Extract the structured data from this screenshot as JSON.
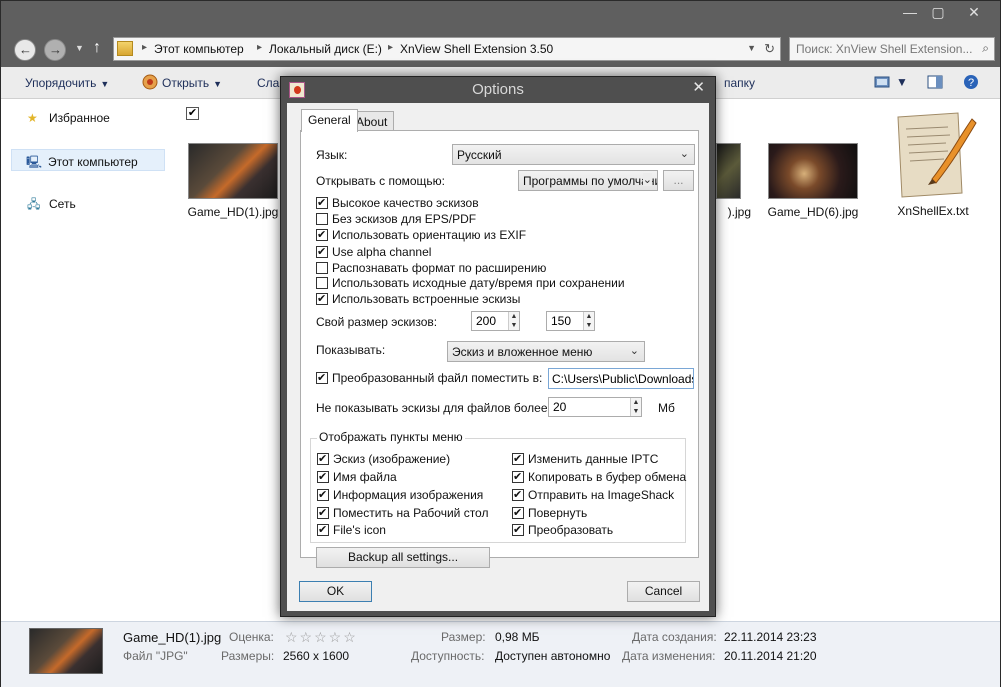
{
  "explorer": {
    "window_controls": [
      "—",
      "▢",
      "✕"
    ],
    "breadcrumb": [
      "Этот компьютер",
      "Локальный диск (E:)",
      "XnView Shell Extension 3.50"
    ],
    "search_placeholder": "Поиск: XnView Shell Extension...",
    "toolbar": {
      "organize": "Упорядочить",
      "open": "Открыть",
      "slideshow_partial": "Сла",
      "folder_partial": "папку"
    },
    "nav": {
      "favorites": "Избранное",
      "this_pc": "Этот компьютер",
      "network": "Сеть"
    },
    "files": [
      {
        "name": "Game_HD(1).jpg"
      },
      {
        "name": ").jpg"
      },
      {
        "name": "Game_HD(6).jpg"
      },
      {
        "name": "XnShellEx.txt"
      }
    ],
    "details": {
      "file_name": "Game_HD(1).jpg",
      "file_type": "Файл \"JPG\"",
      "rating_label": "Оценка:",
      "rating_value": "☆☆☆☆☆",
      "dimensions_label": "Размеры:",
      "dimensions_value": "2560 x 1600",
      "size_label": "Размер:",
      "size_value": "0,98 МБ",
      "availability_label": "Доступность:",
      "availability_value": "Доступен автономно",
      "created_label": "Дата создания:",
      "created_value": "22.11.2014 23:23",
      "modified_label": "Дата изменения:",
      "modified_value": "20.11.2014 21:20"
    }
  },
  "dialog": {
    "title": "Options",
    "close": "✕",
    "tabs": [
      "General",
      "About"
    ],
    "language_label": "Язык:",
    "language_value": "Русский",
    "open_with_label": "Открывать с помощью:",
    "open_with_value": "Программы по умолчани",
    "browse_btn": "...",
    "checkboxes": [
      {
        "label": "Высокое качество эскизов",
        "checked": true
      },
      {
        "label": "Без эскизов для EPS/PDF",
        "checked": false
      },
      {
        "label": "Использовать ориентацию из EXIF",
        "checked": true
      },
      {
        "label": "Use alpha channel",
        "checked": true
      },
      {
        "label": "Распознавать формат по расширению",
        "checked": false
      },
      {
        "label": "Использовать исходные дату/время при сохранении",
        "checked": false
      },
      {
        "label": "Использовать встроенные эскизы",
        "checked": true
      }
    ],
    "thumb_size_label": "Свой размер эскизов:",
    "thumb_width": "200",
    "thumb_height": "150",
    "show_label": "Показывать:",
    "show_value": "Эскиз и вложенное меню",
    "converted_label": "Преобразованный файл поместить в:",
    "converted_checked": true,
    "converted_path": "C:\\Users\\Public\\Downloads",
    "max_size_label": "Не показывать эскизы для файлов более:",
    "max_size_value": "20",
    "max_size_unit": "Мб",
    "menu_group_title": "Отображать пункты меню",
    "menu_left": [
      {
        "label": "Эскиз (изображение)",
        "checked": true
      },
      {
        "label": "Имя файла",
        "checked": true
      },
      {
        "label": "Информация изображения",
        "checked": true
      },
      {
        "label": "Поместить на Рабочий стол",
        "checked": true
      },
      {
        "label": "File's icon",
        "checked": true
      }
    ],
    "menu_right": [
      {
        "label": "Изменить данные IPTC",
        "checked": true
      },
      {
        "label": "Копировать в буфер обмена",
        "checked": true
      },
      {
        "label": "Отправить на ImageShack",
        "checked": true
      },
      {
        "label": "Повернуть",
        "checked": true
      },
      {
        "label": "Преобразовать",
        "checked": true
      }
    ],
    "backup_btn": "Backup all settings...",
    "ok_btn": "OK",
    "cancel_btn": "Cancel"
  }
}
